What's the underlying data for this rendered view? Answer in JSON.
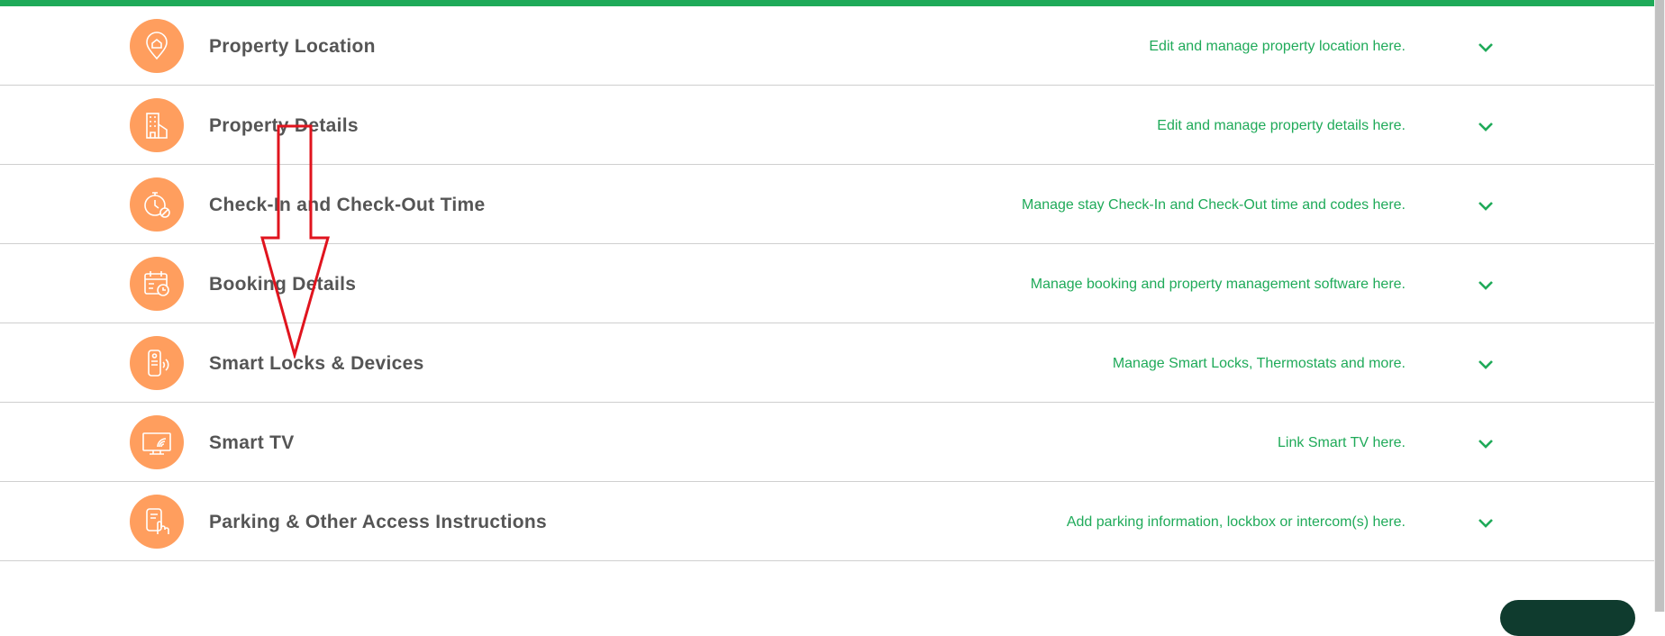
{
  "colors": {
    "accent_green": "#1faa59",
    "icon_orange": "#ff9e5e",
    "title_gray": "#555555",
    "annotation_red": "#e0141e"
  },
  "sections": [
    {
      "title": "Property Location",
      "description": "Edit and manage property location here.",
      "icon": "location-pin-icon"
    },
    {
      "title": "Property Details",
      "description": "Edit and manage property details here.",
      "icon": "building-icon"
    },
    {
      "title": "Check-In and Check-Out Time",
      "description": "Manage stay Check-In and Check-Out time and codes here.",
      "icon": "stopwatch-icon"
    },
    {
      "title": "Booking Details",
      "description": "Manage booking and property management software here.",
      "icon": "calendar-clock-icon"
    },
    {
      "title": "Smart Locks & Devices",
      "description": "Manage Smart Locks, Thermostats and more.",
      "icon": "smart-lock-icon"
    },
    {
      "title": "Smart TV",
      "description": "Link Smart TV here.",
      "icon": "tv-icon"
    },
    {
      "title": "Parking & Other Access Instructions",
      "description": "Add parking information, lockbox or intercom(s) here.",
      "icon": "parking-hand-icon"
    }
  ],
  "annotation": {
    "type": "down-arrow"
  }
}
